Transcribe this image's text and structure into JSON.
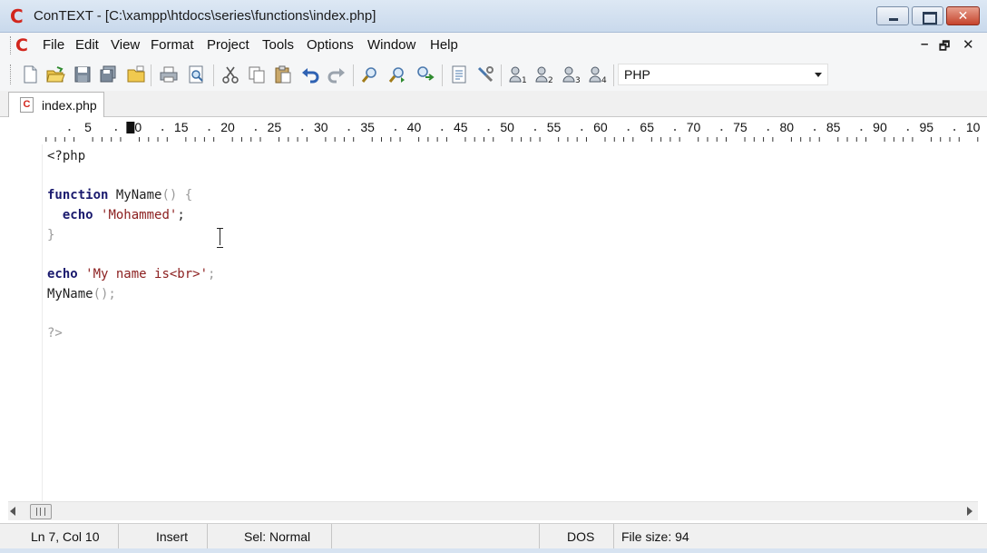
{
  "window": {
    "title": "ConTEXT - [C:\\xampp\\htdocs\\series\\functions\\index.php]",
    "app_icon": "context-logo-icon",
    "close_glyph": "✕"
  },
  "menubar": {
    "items": [
      "File",
      "Edit",
      "View",
      "Format",
      "Project",
      "Tools",
      "Options",
      "Window",
      "Help"
    ],
    "mdi_minimize": "–",
    "mdi_restore": "🗗",
    "mdi_close": "✕"
  },
  "toolbar": {
    "icons": [
      "new-file-icon",
      "open-file-icon",
      "save-icon",
      "save-all-icon",
      "open-folder-icon",
      "print-icon",
      "print-preview-icon",
      "cut-icon",
      "copy-icon",
      "paste-icon",
      "undo-icon",
      "redo-icon",
      "find-icon",
      "find-next-icon",
      "replace-icon",
      "properties-icon",
      "tools-icon",
      "user-command-1-icon",
      "user-command-2-icon",
      "user-command-3-icon",
      "user-command-4-icon"
    ],
    "highlighter": "PHP"
  },
  "tabs": [
    {
      "label": "index.php",
      "active": true
    }
  ],
  "ruler": {
    "labels": [
      "5",
      "10",
      "15",
      "20",
      "25",
      "30",
      "35",
      "40",
      "45",
      "50",
      "55",
      "60",
      "65",
      "70",
      "75",
      "80",
      "85",
      "90",
      "95",
      "10"
    ],
    "cursor_column": 10
  },
  "editor": {
    "lines": [
      [
        {
          "t": "<?php",
          "c": "plain"
        }
      ],
      [],
      [
        {
          "t": "function ",
          "c": "kw"
        },
        {
          "t": "MyName",
          "c": "plain"
        },
        {
          "t": "() {",
          "c": "dim"
        }
      ],
      [
        {
          "t": "  echo ",
          "c": "kw"
        },
        {
          "t": "'Mohammed'",
          "c": "str"
        },
        {
          "t": ";",
          "c": "plain"
        }
      ],
      [
        {
          "t": "}",
          "c": "dim"
        }
      ],
      [],
      [
        {
          "t": "echo ",
          "c": "kw"
        },
        {
          "t": "'My name is<br>'",
          "c": "str"
        },
        {
          "t": ";",
          "c": "dim"
        }
      ],
      [
        {
          "t": "MyName",
          "c": "plain"
        },
        {
          "t": "();",
          "c": "dim"
        }
      ],
      [],
      [
        {
          "t": "?>",
          "c": "dim"
        }
      ]
    ]
  },
  "statusbar": {
    "position": "Ln 7, Col 10",
    "mode": "Insert",
    "selection": "Sel: Normal",
    "blank": "",
    "line_ending": "DOS",
    "file_size": "File size: 94"
  },
  "colors": {
    "keyword": "#1a1a6e",
    "string": "#8b1e1e",
    "punctuation": "#9a9a9a",
    "brand": "#d2261d"
  }
}
